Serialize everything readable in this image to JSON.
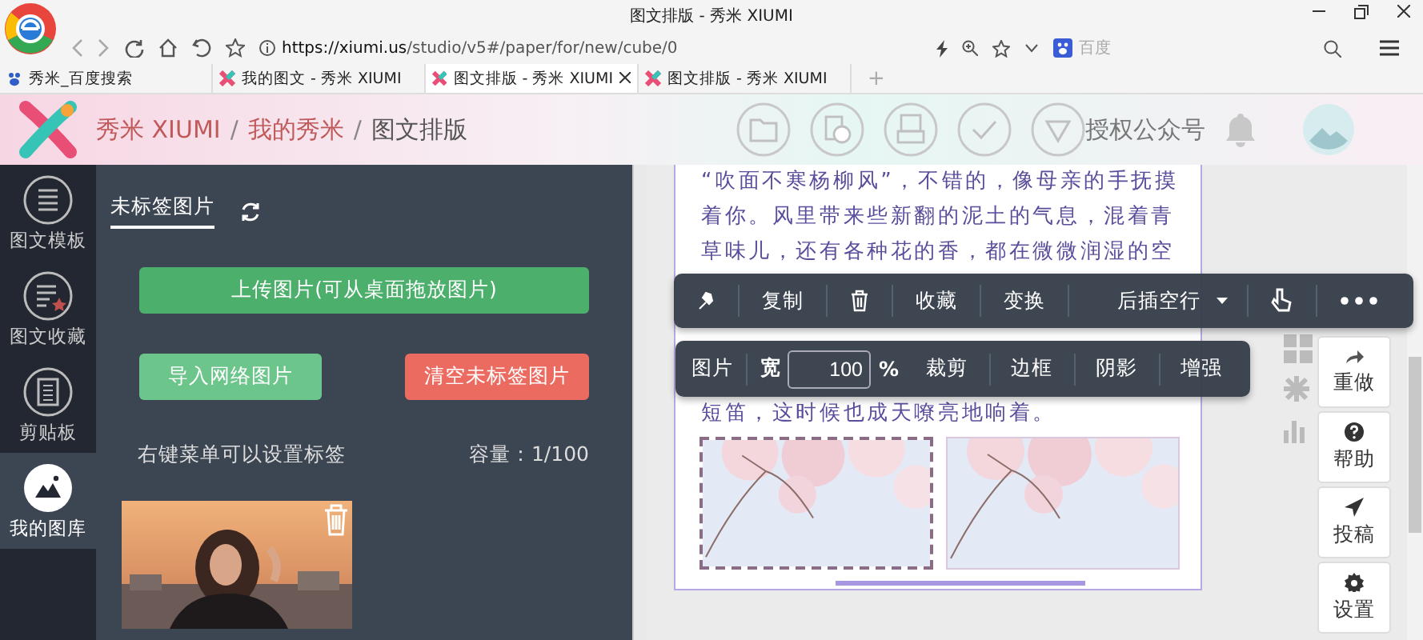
{
  "browser": {
    "title": "图文排版 - 秀米 XIUMI",
    "url_host": "https://xiumi.us",
    "url_path": "/studio/v5#/paper/for/new/cube/0",
    "search_placeholder": "百度",
    "tabs": [
      {
        "label": "秀米_百度搜索",
        "selected": false,
        "kind": "search"
      },
      {
        "label": "我的图文 - 秀米 XIUMI",
        "selected": false,
        "kind": "site"
      },
      {
        "label": "图文排版 - 秀米 XIUMI",
        "selected": true,
        "kind": "site"
      },
      {
        "label": "图文排版 - 秀米 XIUMI",
        "selected": false,
        "kind": "site"
      }
    ],
    "new_tab": "+"
  },
  "header": {
    "breadcrumb": [
      {
        "label": "秀米 XIUMI",
        "selected": false,
        "separator": "/"
      },
      {
        "label": "我的秀米",
        "selected": false,
        "separator": "/"
      },
      {
        "label": "图文排版",
        "selected": true
      }
    ],
    "account_label": "授权公众号"
  },
  "sidebar": {
    "items": [
      {
        "label": "图文模板",
        "selected": false,
        "kind": "lines"
      },
      {
        "label": "图文收藏",
        "selected": false,
        "kind": "star"
      },
      {
        "label": "剪贴板",
        "selected": false,
        "kind": "clipboard"
      },
      {
        "label": "我的图库",
        "selected": true,
        "kind": "mountain"
      }
    ]
  },
  "panel": {
    "tab": {
      "label": "未标签图片",
      "selected": true
    },
    "upload_button": "上传图片(可从桌面拖放图片)",
    "import_button": "导入网络图片",
    "clear_button": "清空未标签图片",
    "hint": "右键菜单可以设置标签",
    "capacity": "容量：1/100",
    "images": [
      {
        "kind": "picture"
      }
    ]
  },
  "editor": {
    "lines": [
      "“吹面不寒杨柳风”，不错的，像母亲的手抚摸",
      "着你。风里带来些新翻的泥土的气息，混着青",
      "草味儿，还有各种花的香，都在微微润湿的空",
      "短笛，这时候也成天嘹亮地响着。"
    ],
    "images": [
      {
        "kind": "picture",
        "selected": true
      },
      {
        "kind": "picture",
        "selected": false
      }
    ]
  },
  "block_toolbar": [
    {
      "kind": "pin"
    },
    {
      "kind": "text",
      "label": "复制"
    },
    {
      "kind": "trash"
    },
    {
      "kind": "text",
      "label": "收藏"
    },
    {
      "kind": "text",
      "label": "变换"
    },
    {
      "kind": "dropdown",
      "label": "后插空行"
    },
    {
      "kind": "pointer"
    },
    {
      "kind": "more"
    }
  ],
  "image_toolbar": {
    "label": "图片",
    "width_label": "宽",
    "width_value": "100",
    "unit": "%",
    "actions": [
      "裁剪",
      "边框",
      "阴影",
      "增强"
    ]
  },
  "tools": [
    {
      "kind": "redo",
      "label": "重做"
    },
    {
      "kind": "help",
      "label": "帮助"
    },
    {
      "kind": "send",
      "label": "投稿"
    },
    {
      "kind": "gear",
      "label": "设置"
    }
  ]
}
